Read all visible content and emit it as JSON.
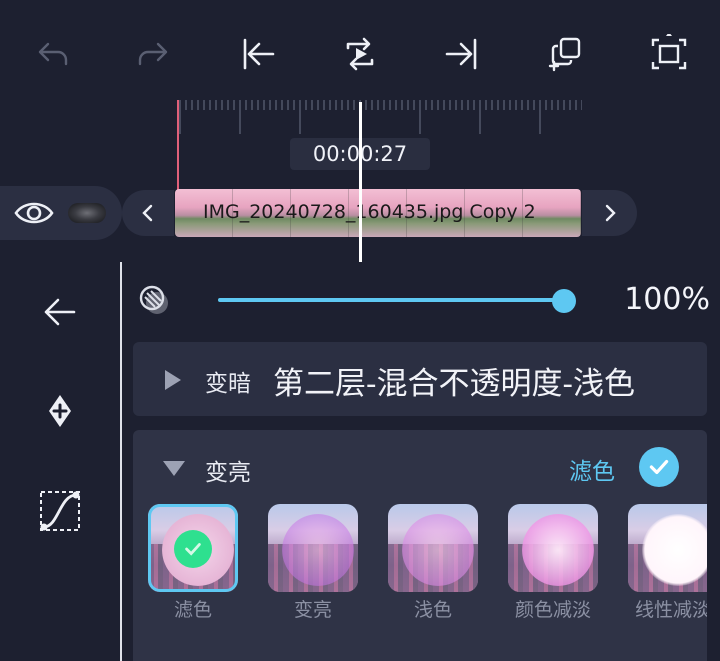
{
  "toolbar": {
    "undo": "undo-icon",
    "redo": "redo-icon",
    "jump_start": "skip-to-start-icon",
    "play_loop": "play-loop-icon",
    "jump_end": "skip-to-end-icon",
    "duplicate": "duplicate-add-icon",
    "fullscreen": "fullscreen-icon"
  },
  "timeline": {
    "timecode": "00:00:27"
  },
  "track": {
    "visibility": "eye-icon",
    "clip_name": "IMG_20240728_160435.jpg Copy 2"
  },
  "sidebar": {
    "back": "back-arrow-icon",
    "keyframe": "keyframe-add-icon",
    "curve": "curve-icon"
  },
  "opacity": {
    "value_label": "100%",
    "value": 1.0
  },
  "blend_groups": {
    "darken": {
      "title": "变暗",
      "note": "第二层-混合不透明度-浅色"
    },
    "lighten": {
      "title": "变亮",
      "selected_name": "滤色",
      "modes": [
        {
          "label": "滤色",
          "selected": true
        },
        {
          "label": "变亮",
          "selected": false
        },
        {
          "label": "浅色",
          "selected": false
        },
        {
          "label": "颜色减淡",
          "selected": false
        },
        {
          "label": "线性减淡",
          "selected": false
        }
      ]
    }
  },
  "colors": {
    "accent": "#5ec8f2",
    "background": "#1d2030",
    "panel": "#2f3346",
    "selected_badge": "#2ee08f"
  }
}
